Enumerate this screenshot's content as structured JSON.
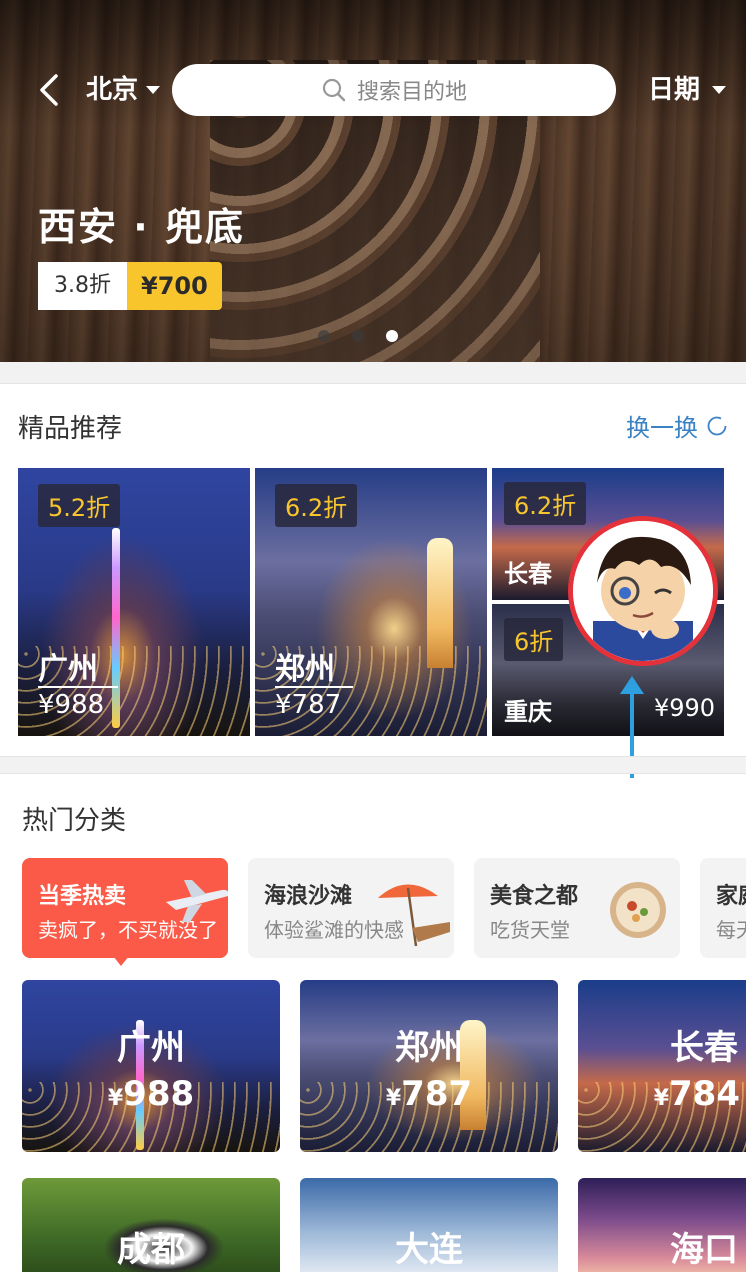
{
  "header": {
    "city": "北京",
    "search_placeholder": "搜索目的地",
    "date_label": "日期"
  },
  "banner": {
    "title": "西安 · 兜底",
    "discount": "3.8折",
    "price": "¥700",
    "slides_count": 3,
    "active_slide": 3
  },
  "featured": {
    "title": "精品推荐",
    "refresh_label": "换一换",
    "items": [
      {
        "discount": "5.2折",
        "city": "广州",
        "price": "¥988"
      },
      {
        "discount": "6.2折",
        "city": "郑州",
        "price": "¥787"
      },
      {
        "discount": "6.2折",
        "city": "长春"
      },
      {
        "discount": "6折",
        "city": "重庆",
        "price": "¥990"
      }
    ]
  },
  "hot": {
    "title": "热门分类",
    "categories": [
      {
        "title": "当季热卖",
        "subtitle": "卖疯了，不买就没了"
      },
      {
        "title": "海浪沙滩",
        "subtitle": "体验鲨滩的快感"
      },
      {
        "title": "美食之都",
        "subtitle": "吃货天堂"
      },
      {
        "title": "家庭",
        "subtitle": "每天"
      }
    ],
    "destinations": [
      {
        "city": "广州",
        "price": "988"
      },
      {
        "city": "郑州",
        "price": "787"
      },
      {
        "city": "长春",
        "price": "784"
      },
      {
        "city": "成都"
      },
      {
        "city": "大连"
      },
      {
        "city": "海口"
      }
    ],
    "currency": "¥"
  },
  "colors": {
    "accent_yellow": "#f8c62c",
    "accent_red": "#fb5a48",
    "link_blue": "#3b82c4",
    "annotation_blue": "#2ea0e0"
  }
}
